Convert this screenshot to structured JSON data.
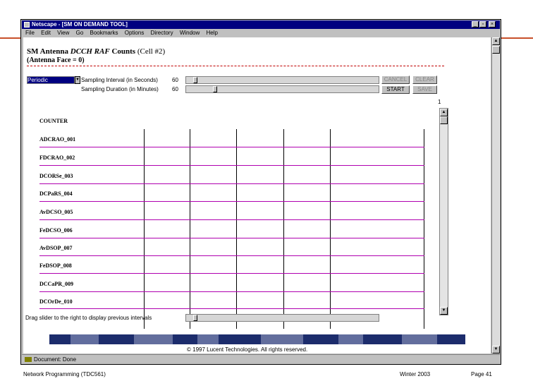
{
  "window": {
    "title": "Netscape - [SM ON DEMAND TOOL]",
    "minimize_glyph": "_",
    "restore_glyph": "▫",
    "close_glyph": "×"
  },
  "menu": [
    "File",
    "Edit",
    "View",
    "Go",
    "Bookmarks",
    "Options",
    "Directory",
    "Window",
    "Help"
  ],
  "page": {
    "heading_prefix": "SM Antenna",
    "heading_emph": "DCCH RAF",
    "heading_mid": "Counts",
    "heading_suffix": "(Cell #2)",
    "subheading": "(Antenna Face = 0)"
  },
  "controls": {
    "mode_select": "Periodic",
    "interval_label": "Sampling Interval (in Seconds)",
    "interval_value": "60",
    "duration_label": "Sampling Duration (in Minutes)",
    "duration_value": "60",
    "cancel_button": "CANCEL",
    "clear_button": "CLEAR",
    "start_button": "START",
    "save_button": "SAVE",
    "page_indicator": "1"
  },
  "table": {
    "header": "COUNTER",
    "rows": [
      "ADCRAO_001",
      "FDCRAO_002",
      "DCORSe_003",
      "DCPaRS_004",
      "AvDCSO_005",
      "FeDCSO_006",
      "AvDSOP_007",
      "FeDSOP_008",
      "DCCaPR_009",
      "DCOrDe_010"
    ]
  },
  "drag_hint": "Drag slider to the right to display previous intervals",
  "copyright": "© 1997 Lucent Technologies. All rights reserved.",
  "status": {
    "text": "Document: Done"
  },
  "footer": {
    "left": "Network Programming (TDC561)",
    "middle": "Winter 2003",
    "right": "Page 41"
  },
  "colors": {
    "title_bar": "#000080",
    "accent_rule": "#c8502a",
    "row_line": "#b000b0",
    "banner": "#1c2c6c"
  },
  "icons": {
    "dropdown": "down-arrow-icon",
    "scroll_up": "up-arrow-icon",
    "scroll_down": "down-arrow-icon"
  }
}
